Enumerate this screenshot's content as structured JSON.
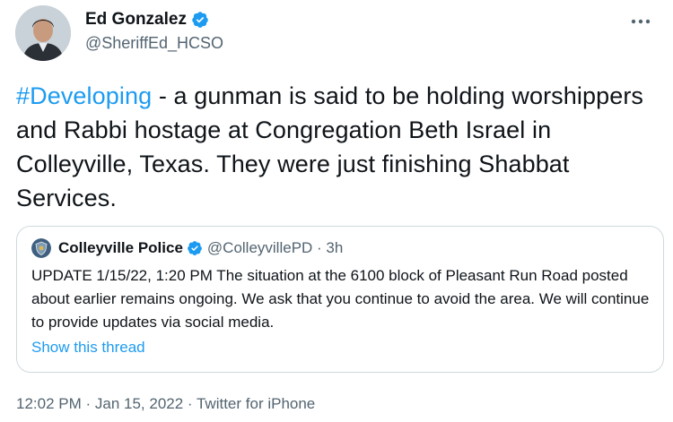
{
  "author": {
    "name": "Ed Gonzalez",
    "handle": "@SheriffEd_HCSO",
    "verified": true
  },
  "tweet": {
    "hashtag": "#Developing",
    "text": " - a gunman is said to be holding worshippers and Rabbi hostage at Congregation Beth Israel in Colleyville, Texas. They were just finishing Shabbat Services."
  },
  "quoted": {
    "name": "Colleyville Police",
    "handle_time": "@ColleyvillePD · 3h",
    "verified": true,
    "text": "UPDATE 1/15/22, 1:20 PM The situation at the 6100 block of Pleasant Run Road posted about earlier remains ongoing. We ask that you continue to avoid the area. We will continue to provide updates via social media.",
    "show_thread_label": "Show this thread"
  },
  "meta": {
    "timestamp": "12:02 PM · Jan 15, 2022 · Twitter for iPhone"
  },
  "colors": {
    "link": "#1d9bf0",
    "secondary_text": "#536471",
    "primary_text": "#0f1419",
    "border": "#cfd9de"
  },
  "icons": {
    "verified": "verified-badge-icon",
    "more": "more-options-icon"
  }
}
